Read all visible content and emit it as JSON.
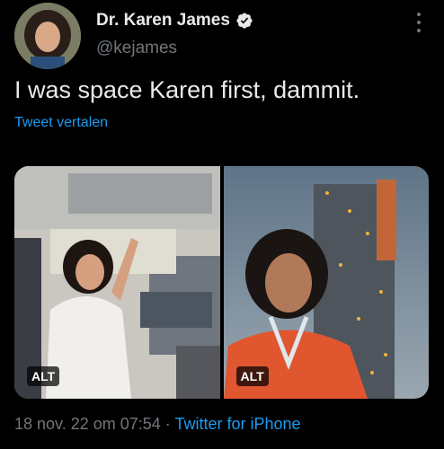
{
  "author": {
    "name": "Dr. Karen James",
    "handle": "@kejames",
    "verified_icon": "verified-badge-icon"
  },
  "tweet": {
    "text": "I was space Karen first, dammit.",
    "translate_label": "Tweet vertalen"
  },
  "media": [
    {
      "alt_label": "ALT"
    },
    {
      "alt_label": "ALT"
    }
  ],
  "meta": {
    "timestamp": "18 nov. 22 om 07:54",
    "separator": " · ",
    "source": "Twitter for iPhone"
  },
  "colors": {
    "background": "#000000",
    "text": "#e7e9ea",
    "secondary": "#71767b",
    "link": "#1d9bf0"
  }
}
